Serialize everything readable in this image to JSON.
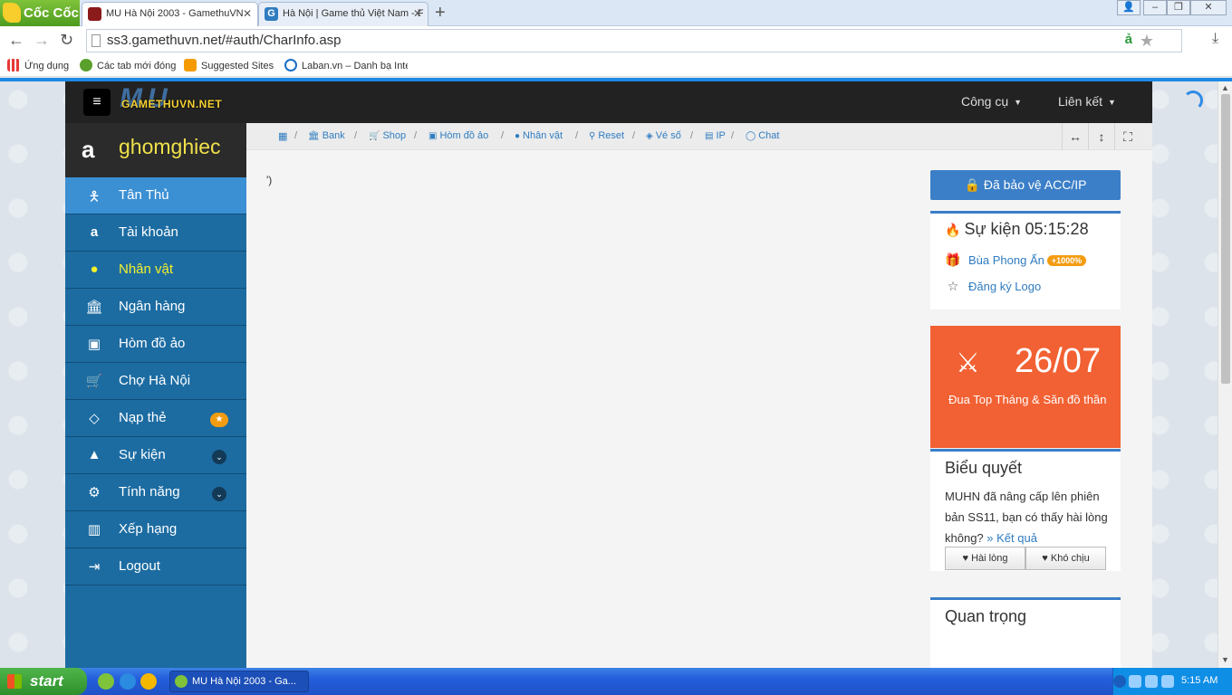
{
  "browser": {
    "brand": "Cốc Cốc",
    "tabs": [
      {
        "title": "MU Hà Nội 2003 - GamethuVN",
        "active": true
      },
      {
        "title": "Hà Nội | Game thủ Việt Nam - F",
        "active": false
      }
    ],
    "url": "ss3.gamethuvn.net/#auth/CharInfo.asp",
    "bookmarks": [
      "Ứng dụng",
      "Các tab mới đóng",
      "Suggested Sites",
      "Laban.vn – Danh bạ Inte"
    ],
    "accent": "#1e88e5"
  },
  "site": {
    "logo_big": "MU",
    "logo_small": "GAMETHUVN.NET",
    "top_menu": [
      "Công cụ",
      "Liên kết"
    ]
  },
  "sidebar": {
    "username": "ghomghiec",
    "items": [
      {
        "label": "Tân Thủ",
        "icon": "user-plus-icon",
        "active": true
      },
      {
        "label": "Tài khoản",
        "icon": "amazon-icon"
      },
      {
        "label": "Nhân vật",
        "icon": "user-icon",
        "highlight": true
      },
      {
        "label": "Ngân hàng",
        "icon": "bank-icon"
      },
      {
        "label": "Hòm đồ ảo",
        "icon": "briefcase-icon"
      },
      {
        "label": "Chợ Hà Nội",
        "icon": "cart-icon"
      },
      {
        "label": "Nạp thẻ",
        "icon": "diamond-icon",
        "badge": "star"
      },
      {
        "label": "Sự kiện",
        "icon": "android-icon",
        "badge": "chevron"
      },
      {
        "label": "Tính năng",
        "icon": "cogs-icon",
        "badge": "chevron"
      },
      {
        "label": "Xếp hạng",
        "icon": "bar-chart-icon"
      },
      {
        "label": "Logout",
        "icon": "sign-out-icon"
      }
    ]
  },
  "breadcrumbs": [
    "Bank",
    "Shop",
    "Hòm đồ ảo",
    "Nhân vật",
    "Reset",
    "Vé số",
    "IP",
    "Chat"
  ],
  "content": {
    "stray_text": "')"
  },
  "widgets": {
    "protect_button": "Đã bảo vệ ACC/IP",
    "event": {
      "title": "Sự kiện 05:15:28",
      "item1": "Bùa Phong Ấn",
      "item1_badge": "+1000%",
      "item2": "Đăng ký Logo"
    },
    "promo": {
      "date": "26/07",
      "text": "Đua Top Tháng & Săn đồ thần",
      "color": "#f26133"
    },
    "poll": {
      "title": "Biểu quyết",
      "question": "MUHN đã nâng cấp lên phiên bản SS11, bạn có thấy hài lòng không?",
      "result_link": "Kết quả",
      "option1": "Hài lòng",
      "option2": "Khó chịu"
    },
    "important": {
      "title": "Quan trọng"
    }
  },
  "taskbar": {
    "start": "start",
    "task": "MU Hà Nội 2003 - Ga...",
    "clock": "5:15 AM"
  }
}
